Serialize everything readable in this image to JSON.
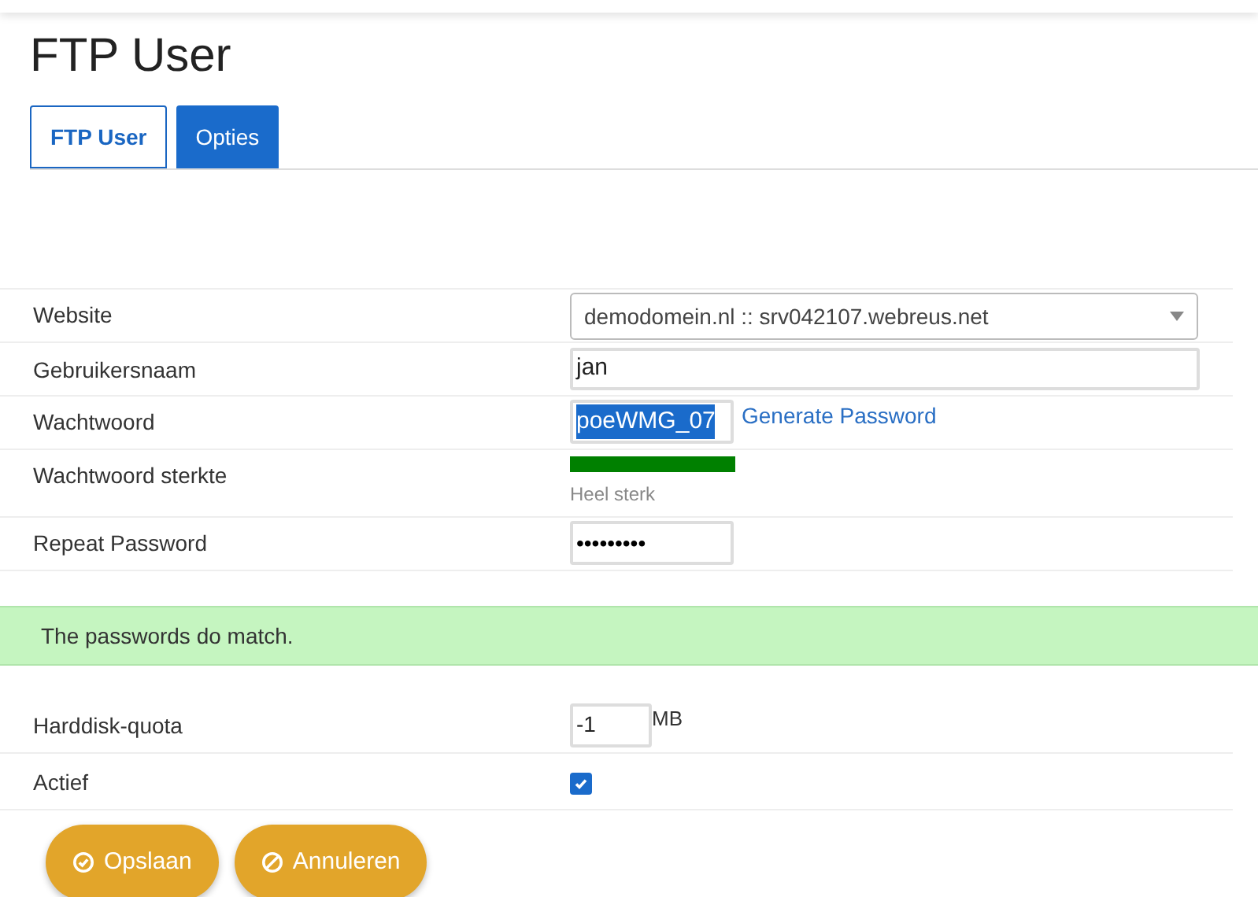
{
  "title": "FTP User",
  "tabs": [
    {
      "label": "FTP User",
      "selected": true
    },
    {
      "label": "Opties",
      "selected": false
    }
  ],
  "form": {
    "website": {
      "label": "Website",
      "value": "demodomein.nl :: srv042107.webreus.net"
    },
    "username": {
      "label": "Gebruikersnaam",
      "value": "jan"
    },
    "password": {
      "label": "Wachtwoord",
      "value": "poeWMG_07",
      "text_selected": true,
      "link": "Generate Password"
    },
    "strength": {
      "label": "Wachtwoord sterkte",
      "reading": "Heel sterk"
    },
    "repeat": {
      "label": "Repeat Password",
      "value": "•••••••••"
    },
    "alert": "The passwords do match.",
    "quota": {
      "label": "Harddisk-quota",
      "value": "-1",
      "unit": "MB"
    },
    "active": {
      "label": "Actief",
      "checked": true
    }
  },
  "buttons": [
    {
      "kind": "save",
      "label": "Opslaan"
    },
    {
      "kind": "cancel",
      "label": "Annuleren"
    }
  ]
}
